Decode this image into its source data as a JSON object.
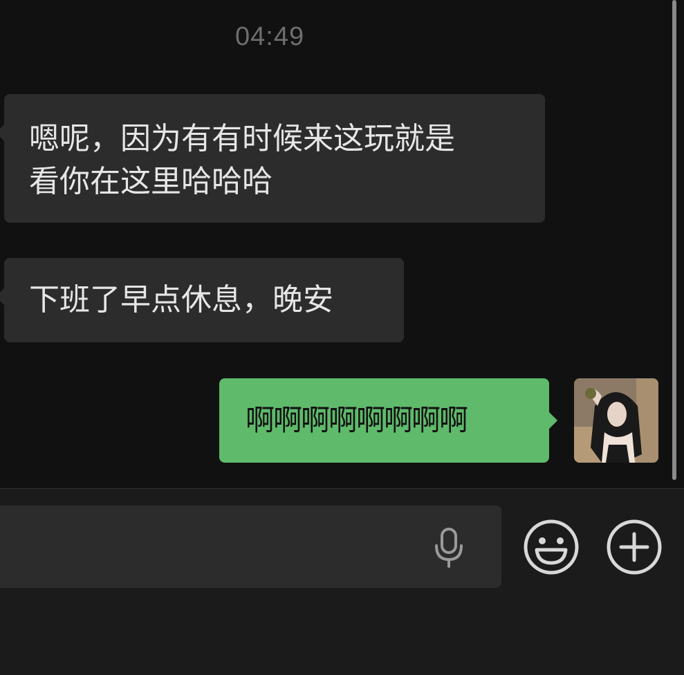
{
  "chat": {
    "timestamp": "04:49",
    "messages": [
      {
        "direction": "incoming",
        "text": "嗯呢，因为有有时候来这玩就是\n看你在这里哈哈哈"
      },
      {
        "direction": "incoming",
        "text": "下班了早点休息，晚安"
      },
      {
        "direction": "outgoing",
        "text": "啊啊啊啊啊啊啊啊"
      }
    ]
  },
  "composer": {
    "input_value": "",
    "icons": [
      "microphone-icon",
      "emoji-icon",
      "plus-icon"
    ]
  },
  "colors": {
    "background": "#111111",
    "incoming_bubble": "#2c2c2c",
    "outgoing_bubble": "#5fba6b",
    "input_bar": "#1b1b1b"
  }
}
